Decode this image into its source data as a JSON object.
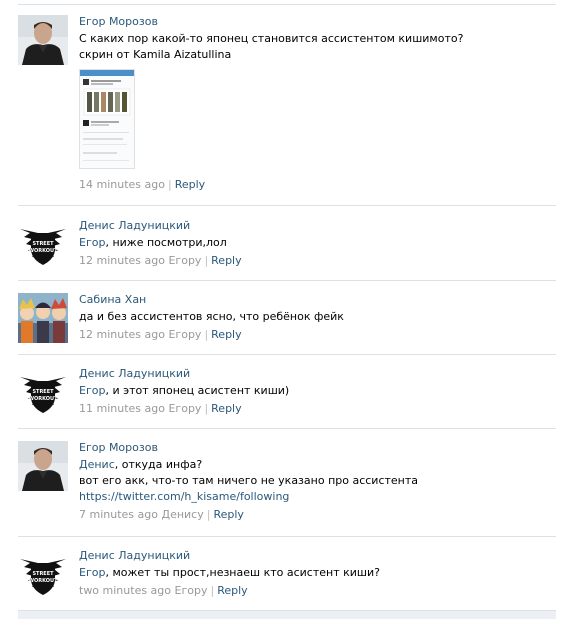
{
  "comments": [
    {
      "author": "Егор Морозов",
      "lines": [
        "С каких пор какой-то японец становится ассистентом кишимото?",
        "скрин от Kamila Aizatullina"
      ],
      "time": "14 minutes ago",
      "reply_to": "",
      "reply_label": "Reply",
      "avatar": "person-dark-jacket"
    },
    {
      "author": "Денис Ладуницкий",
      "mention": "Егор",
      "text": ", ниже посмотри,лол",
      "time": "12 minutes ago",
      "reply_to": "Егору",
      "reply_label": "Reply",
      "avatar": "street-workout-logo"
    },
    {
      "author": "Сабина Хан",
      "text": "да и без ассистентов ясно, что ребёнок фейк",
      "time": "12 minutes ago",
      "reply_to": "Егору",
      "reply_label": "Reply",
      "avatar": "anime-group"
    },
    {
      "author": "Денис Ладуницкий",
      "mention": "Егор",
      "text": ", и этот японец асистент киши)",
      "time": "11 minutes ago",
      "reply_to": "Егору",
      "reply_label": "Reply",
      "avatar": "street-workout-logo"
    },
    {
      "author": "Егор Морозов",
      "mention": "Денис",
      "text": ", откуда инфа?",
      "line2": "вот его акк, что-то там ничего не указано про ассистента",
      "url": "https://twitter.com/h_kisame/following",
      "time": "7 minutes ago",
      "reply_to": "Денису",
      "reply_label": "Reply",
      "avatar": "person-dark-jacket"
    },
    {
      "author": "Денис Ладуницкий",
      "mention": "Егор",
      "text": ", может ты прост,незнаеш кто асистент киши?",
      "time": "two minutes ago",
      "reply_to": "Егору",
      "reply_label": "Reply",
      "avatar": "street-workout-logo"
    }
  ],
  "logo_text": [
    "STREET",
    "WORKOUT"
  ],
  "colors": {
    "link": "#2b587a",
    "meta": "#999999",
    "divider": "#dae1e8"
  }
}
